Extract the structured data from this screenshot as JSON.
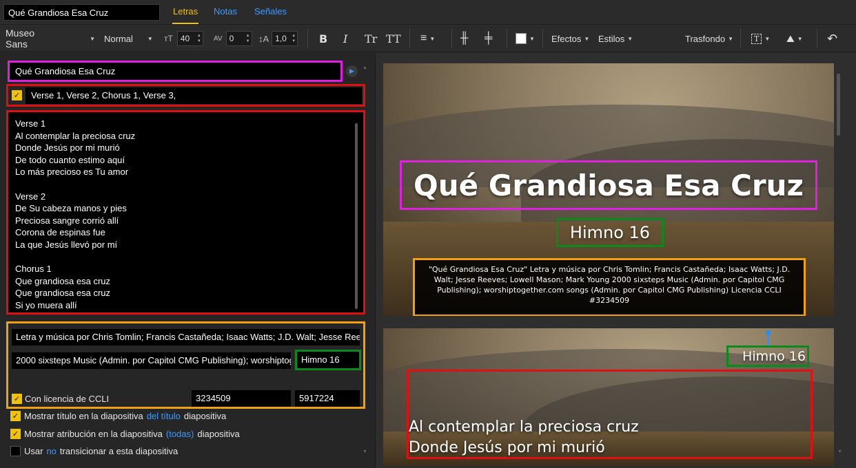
{
  "header": {
    "title_value": "Qué Grandiosa Esa Cruz",
    "tabs": [
      {
        "label": "Letras",
        "active": true
      },
      {
        "label": "Notas",
        "active": false
      },
      {
        "label": "Señales",
        "active": false
      }
    ]
  },
  "toolbar": {
    "font_family": "Museo Sans",
    "font_weight": "Normal",
    "font_size": "40",
    "tracking": "0",
    "line_height": "1,0",
    "bold": "B",
    "italic": "I",
    "text_case": "Tr",
    "all_caps": "TT",
    "effects_label": "Efectos",
    "styles_label": "Estilos",
    "background_label": "Trasfondo",
    "swatch_color": "#ffffff"
  },
  "editor": {
    "song_title": "Qué Grandiosa Esa Cruz",
    "order_value": "Verse 1, Verse 2, Chorus 1, Verse 3,",
    "lyrics": "Verse 1\nAl contemplar la preciosa cruz\nDonde Jesús por mi murió\nDe todo cuanto estimo aquí\nLo más precioso es Tu amor\n\nVerse 2\nDe Su cabeza manos y pies\nPreciosa sangre corrió allí\nCorona de espinas fue\nLa que Jesús llevó por mí\n\nChorus 1\nQue grandiosa esa cruz\nQue grandiosa esa cruz\nSi yo muera allí",
    "authors_value": "Letra y música por Chris Tomlin; Francis Castañeda; Isaac Watts; J.D. Walt; Jesse Reeves",
    "copyright_value": "2000 sixsteps Music (Admin. por Capitol CMG Publishing); worshiptogether.com",
    "hymn_value": "Himno 16",
    "ccli_label": "Con licencia de CCLI",
    "ccli_license": "3234509",
    "ccli_song": "5917224"
  },
  "options": [
    {
      "checked": true,
      "pre": "Mostrar título en la diapositiva",
      "link": "del título",
      "post": "diapositiva"
    },
    {
      "checked": true,
      "pre": "Mostrar atribución en la diapositiva",
      "link": "(todas)",
      "post": "diapositiva"
    },
    {
      "checked": false,
      "pre": "Usar",
      "link": "no",
      "post": "transicionar a esta diapositiva"
    }
  ],
  "slides": {
    "slide1": {
      "title": "Qué Grandiosa Esa Cruz",
      "hymn": "Himno 16",
      "credit": "\"Qué Grandiosa Esa Cruz\" Letra y música por Chris Tomlin; Francis Castañeda; Isaac Watts; J.D. Walt; Jesse Reeves; Lowell Mason; Mark Young 2000 sixsteps Music (Admin. por Capitol CMG Publishing); worshiptogether.com songs (Admin. por Capitol CMG Publishing) Licencia CCLI #3234509"
    },
    "slide2": {
      "hymn": "Himno 16",
      "line1": "Al contemplar la preciosa cruz",
      "line2": "Donde Jesús por mi murió"
    }
  },
  "colors": {
    "accent_yellow": "#f2c200",
    "link_blue": "#3d9bff",
    "highlight_magenta": "#e020e0",
    "highlight_red": "#e01010",
    "highlight_orange": "#f0a010",
    "highlight_green": "#0a8a1a"
  }
}
